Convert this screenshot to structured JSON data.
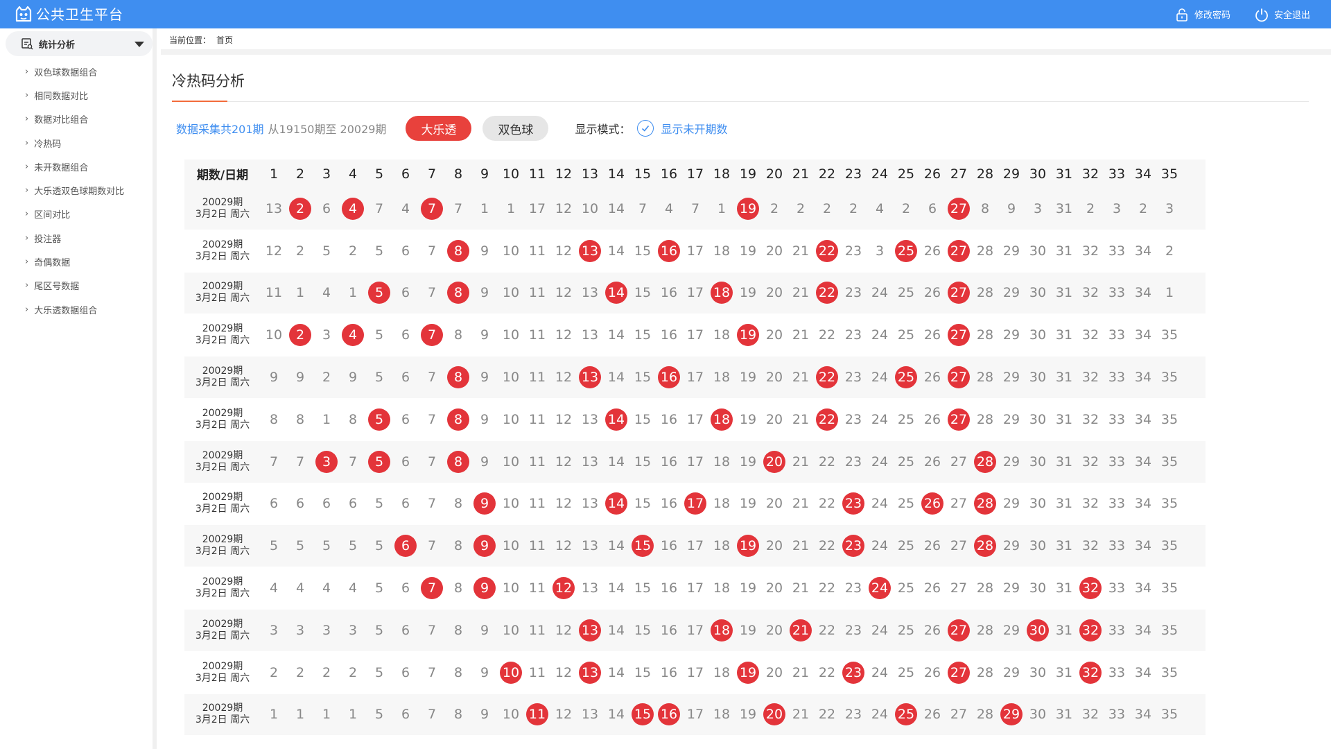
{
  "app": {
    "title": "公共卫生平台",
    "change_password": "修改密码",
    "logout": "安全退出",
    "accent": "#3f8ef0",
    "hit_color": "#e3343a"
  },
  "sidebar": {
    "group_label": "统计分析",
    "items": [
      {
        "label": "双色球数据组合"
      },
      {
        "label": "相同数据对比"
      },
      {
        "label": "数据对比组合"
      },
      {
        "label": "冷热码"
      },
      {
        "label": "未开数据组合"
      },
      {
        "label": "大乐透双色球期数对比"
      },
      {
        "label": "区间对比"
      },
      {
        "label": "投注器"
      },
      {
        "label": "奇偶数据"
      },
      {
        "label": "尾区号数据"
      },
      {
        "label": "大乐透数据组合"
      }
    ]
  },
  "breadcrumb": {
    "prefix": "当前位置：",
    "current": "首页"
  },
  "page": {
    "title": "冷热码分析",
    "count_text": "数据采集共201期",
    "range_text": "从19150期至 20029期",
    "btn_dlt": "大乐透",
    "btn_ssq": "双色球",
    "mode_label": "显示模式：",
    "mode_option": "显示未开期数"
  },
  "table": {
    "header_date": "期数/日期",
    "columns": [
      "1",
      "2",
      "3",
      "4",
      "5",
      "6",
      "7",
      "8",
      "9",
      "10",
      "11",
      "12",
      "13",
      "14",
      "15",
      "16",
      "17",
      "18",
      "19",
      "20",
      "21",
      "22",
      "23",
      "24",
      "25",
      "26",
      "27",
      "28",
      "29",
      "30",
      "31",
      "32",
      "33",
      "34",
      "35"
    ],
    "rows": [
      {
        "period": "20029期",
        "date": "3月2日 周六",
        "cells": [
          "13",
          "2",
          "6",
          "4",
          "7",
          "4",
          "7",
          "7",
          "1",
          "1",
          "17",
          "12",
          "10",
          "14",
          "7",
          "4",
          "7",
          "1",
          "19",
          "2",
          "2",
          "2",
          "2",
          "4",
          "2",
          "6",
          "27",
          "8",
          "9",
          "3",
          "31",
          "2",
          "3",
          "2",
          "3"
        ],
        "hits": [
          2,
          4,
          7,
          19,
          27
        ]
      },
      {
        "period": "20029期",
        "date": "3月2日 周六",
        "cells": [
          "12",
          "2",
          "5",
          "2",
          "5",
          "6",
          "7",
          "8",
          "9",
          "10",
          "11",
          "12",
          "13",
          "14",
          "15",
          "16",
          "17",
          "18",
          "19",
          "20",
          "21",
          "22",
          "23",
          "3",
          "25",
          "26",
          "27",
          "28",
          "29",
          "30",
          "31",
          "32",
          "33",
          "34",
          "2"
        ],
        "hits": [
          8,
          13,
          16,
          22,
          25,
          27
        ]
      },
      {
        "period": "20029期",
        "date": "3月2日 周六",
        "cells": [
          "11",
          "1",
          "4",
          "1",
          "5",
          "6",
          "7",
          "8",
          "9",
          "10",
          "11",
          "12",
          "13",
          "14",
          "15",
          "16",
          "17",
          "18",
          "19",
          "20",
          "21",
          "22",
          "23",
          "24",
          "25",
          "26",
          "27",
          "28",
          "29",
          "30",
          "31",
          "32",
          "33",
          "34",
          "1"
        ],
        "hits": [
          5,
          8,
          14,
          18,
          22,
          27
        ]
      },
      {
        "period": "20029期",
        "date": "3月2日 周六",
        "cells": [
          "10",
          "2",
          "3",
          "4",
          "5",
          "6",
          "7",
          "8",
          "9",
          "10",
          "11",
          "12",
          "13",
          "14",
          "15",
          "16",
          "17",
          "18",
          "19",
          "20",
          "21",
          "22",
          "23",
          "24",
          "25",
          "26",
          "27",
          "28",
          "29",
          "30",
          "31",
          "32",
          "33",
          "34",
          "35"
        ],
        "hits": [
          2,
          4,
          7,
          19,
          27
        ]
      },
      {
        "period": "20029期",
        "date": "3月2日 周六",
        "cells": [
          "9",
          "9",
          "2",
          "9",
          "5",
          "6",
          "7",
          "8",
          "9",
          "10",
          "11",
          "12",
          "13",
          "14",
          "15",
          "16",
          "17",
          "18",
          "19",
          "20",
          "21",
          "22",
          "23",
          "24",
          "25",
          "26",
          "27",
          "28",
          "29",
          "30",
          "31",
          "32",
          "33",
          "34",
          "35"
        ],
        "hits": [
          8,
          13,
          16,
          22,
          25,
          27
        ]
      },
      {
        "period": "20029期",
        "date": "3月2日 周六",
        "cells": [
          "8",
          "8",
          "1",
          "8",
          "5",
          "6",
          "7",
          "8",
          "9",
          "10",
          "11",
          "12",
          "13",
          "14",
          "15",
          "16",
          "17",
          "18",
          "19",
          "20",
          "21",
          "22",
          "23",
          "24",
          "25",
          "26",
          "27",
          "28",
          "29",
          "30",
          "31",
          "32",
          "33",
          "34",
          "35"
        ],
        "hits": [
          5,
          8,
          14,
          18,
          22,
          27
        ]
      },
      {
        "period": "20029期",
        "date": "3月2日 周六",
        "cells": [
          "7",
          "7",
          "3",
          "7",
          "5",
          "6",
          "7",
          "8",
          "9",
          "10",
          "11",
          "12",
          "13",
          "14",
          "15",
          "16",
          "17",
          "18",
          "19",
          "20",
          "21",
          "22",
          "23",
          "24",
          "25",
          "26",
          "27",
          "28",
          "29",
          "30",
          "31",
          "32",
          "33",
          "34",
          "35"
        ],
        "hits": [
          3,
          5,
          8,
          20,
          28
        ]
      },
      {
        "period": "20029期",
        "date": "3月2日 周六",
        "cells": [
          "6",
          "6",
          "6",
          "6",
          "5",
          "6",
          "7",
          "8",
          "9",
          "10",
          "11",
          "12",
          "13",
          "14",
          "15",
          "16",
          "17",
          "18",
          "19",
          "20",
          "21",
          "22",
          "23",
          "24",
          "25",
          "26",
          "27",
          "28",
          "29",
          "30",
          "31",
          "32",
          "33",
          "34",
          "35"
        ],
        "hits": [
          9,
          14,
          17,
          23,
          26,
          28
        ]
      },
      {
        "period": "20029期",
        "date": "3月2日 周六",
        "cells": [
          "5",
          "5",
          "5",
          "5",
          "5",
          "6",
          "7",
          "8",
          "9",
          "10",
          "11",
          "12",
          "13",
          "14",
          "15",
          "16",
          "17",
          "18",
          "19",
          "20",
          "21",
          "22",
          "23",
          "24",
          "25",
          "26",
          "27",
          "28",
          "29",
          "30",
          "31",
          "32",
          "33",
          "34",
          "35"
        ],
        "hits": [
          6,
          9,
          15,
          19,
          23,
          28
        ]
      },
      {
        "period": "20029期",
        "date": "3月2日 周六",
        "cells": [
          "4",
          "4",
          "4",
          "4",
          "5",
          "6",
          "7",
          "8",
          "9",
          "10",
          "11",
          "12",
          "13",
          "14",
          "15",
          "16",
          "17",
          "18",
          "19",
          "20",
          "21",
          "22",
          "23",
          "24",
          "25",
          "26",
          "27",
          "28",
          "29",
          "30",
          "31",
          "32",
          "33",
          "34",
          "35"
        ],
        "hits": [
          7,
          9,
          12,
          24,
          32
        ]
      },
      {
        "period": "20029期",
        "date": "3月2日 周六",
        "cells": [
          "3",
          "3",
          "3",
          "3",
          "5",
          "6",
          "7",
          "8",
          "9",
          "10",
          "11",
          "12",
          "13",
          "14",
          "15",
          "16",
          "17",
          "18",
          "19",
          "20",
          "21",
          "22",
          "23",
          "24",
          "25",
          "26",
          "27",
          "28",
          "29",
          "30",
          "31",
          "32",
          "33",
          "34",
          "35"
        ],
        "hits": [
          13,
          18,
          21,
          27,
          30,
          32
        ]
      },
      {
        "period": "20029期",
        "date": "3月2日 周六",
        "cells": [
          "2",
          "2",
          "2",
          "2",
          "5",
          "6",
          "7",
          "8",
          "9",
          "10",
          "11",
          "12",
          "13",
          "14",
          "15",
          "16",
          "17",
          "18",
          "19",
          "20",
          "21",
          "22",
          "23",
          "24",
          "25",
          "26",
          "27",
          "28",
          "29",
          "30",
          "31",
          "32",
          "33",
          "34",
          "35"
        ],
        "hits": [
          10,
          13,
          19,
          23,
          27,
          32
        ]
      },
      {
        "period": "20029期",
        "date": "3月2日 周六",
        "cells": [
          "1",
          "1",
          "1",
          "1",
          "5",
          "6",
          "7",
          "8",
          "9",
          "10",
          "11",
          "12",
          "13",
          "14",
          "15",
          "16",
          "17",
          "18",
          "19",
          "20",
          "21",
          "22",
          "23",
          "24",
          "25",
          "26",
          "27",
          "28",
          "29",
          "30",
          "31",
          "32",
          "33",
          "34",
          "35"
        ],
        "hits": [
          11,
          15,
          16,
          20,
          25,
          29
        ]
      }
    ]
  }
}
